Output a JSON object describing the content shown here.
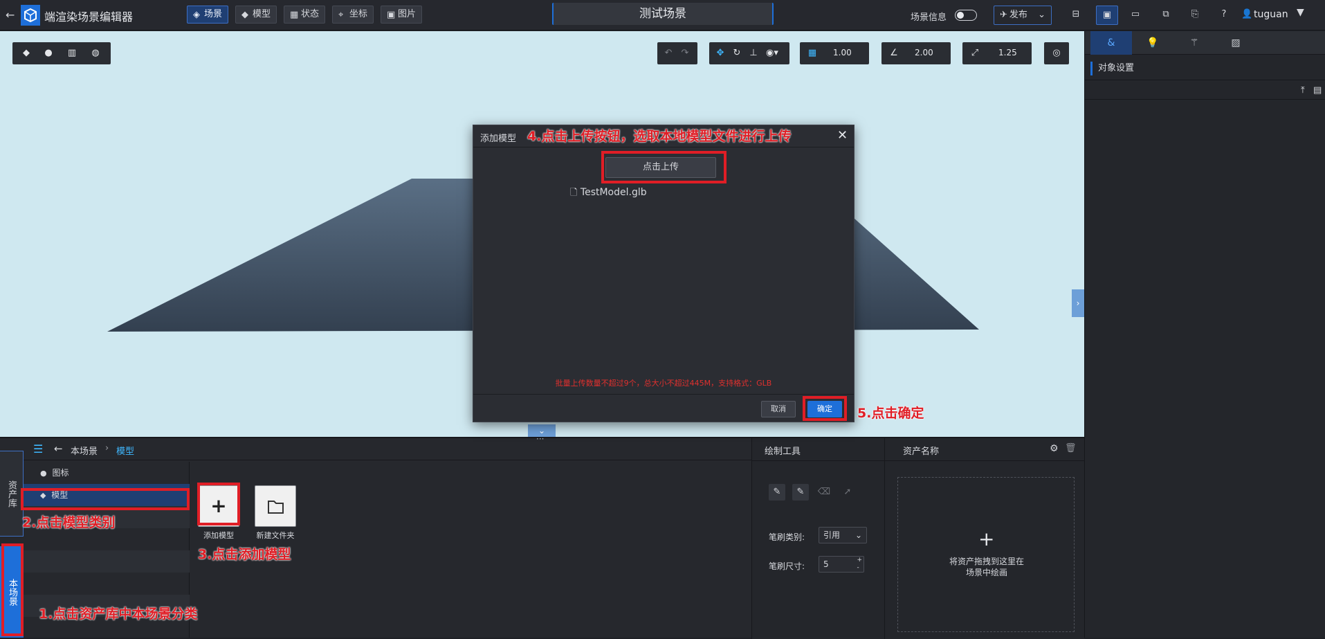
{
  "app": {
    "title": "端渲染场景编辑器",
    "scene_name": "测试场景"
  },
  "top_tabs": [
    {
      "label": "场景",
      "active": true
    },
    {
      "label": "模型",
      "active": false
    },
    {
      "label": "状态",
      "active": false
    },
    {
      "label": "坐标",
      "active": false
    },
    {
      "label": "图片",
      "active": false
    }
  ],
  "top_right": {
    "scene_info_label": "场景信息",
    "publish_label": "发布",
    "username": "tuguan"
  },
  "viewport_toolbar": {
    "grid_value": "1.00",
    "angle_value": "2.00",
    "scale_value": "1.25"
  },
  "right_panel": {
    "section_title": "对象设置"
  },
  "bottom": {
    "side_tabs": [
      "资产库",
      "本场景"
    ],
    "breadcrumb": {
      "root": "本场景",
      "current": "模型"
    },
    "categories": [
      "图标",
      "模型"
    ],
    "tiles": [
      "添加模型",
      "新建文件夹"
    ],
    "draw_tools": {
      "title": "绘制工具",
      "brush_type_label": "笔刷类别:",
      "brush_type_value": "引用",
      "brush_size_label": "笔刷尺寸:",
      "brush_size_value": "5"
    },
    "asset_panel": {
      "title": "资产名称",
      "drop_text_line1": "将资产拖拽到这里在",
      "drop_text_line2": "场景中绘画"
    }
  },
  "modal": {
    "title": "添加模型",
    "upload_button": "点击上传",
    "file_name": "TestModel.glb",
    "hint": "批量上传数量不超过9个，总大小不超过445M，支持格式：GLB",
    "cancel_button": "取消",
    "confirm_button": "确定"
  },
  "annotations": {
    "step1": "1.点击资产库中本场景分类",
    "step2": "2.点击模型类别",
    "step3": "3.点击添加模型",
    "step4": "4.点击上传按钮，选取本地模型文件进行上传",
    "step5": "5.点击确定"
  },
  "colors": {
    "accent": "#1e6fd9",
    "annotation_red": "#e01e26",
    "sky": "#cfe8f0"
  }
}
